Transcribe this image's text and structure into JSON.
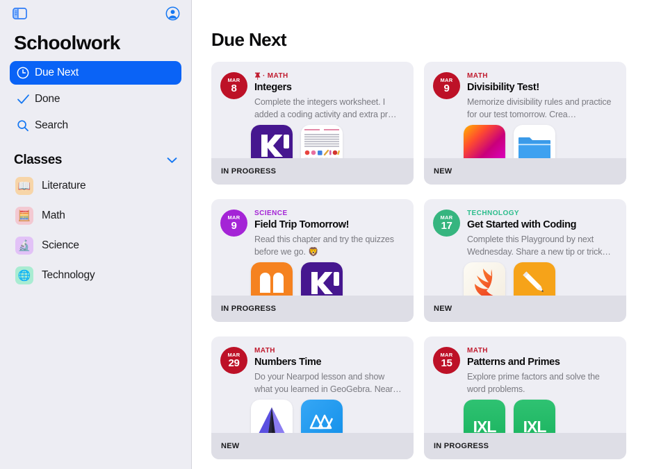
{
  "sidebar": {
    "toggle_icon": "sidebar-toggle-icon",
    "account_icon": "account-circle-icon",
    "app_title": "Schoolwork",
    "nav": [
      {
        "label": "Due Next",
        "icon": "clock-icon",
        "selected": true
      },
      {
        "label": "Done",
        "icon": "checkmark-icon",
        "selected": false
      },
      {
        "label": "Search",
        "icon": "search-icon",
        "selected": false
      }
    ],
    "classes_section": {
      "title": "Classes",
      "collapse_icon": "chevron-down-icon",
      "items": [
        {
          "label": "Literature",
          "emoji": "📖",
          "bg": "#f7d5a8"
        },
        {
          "label": "Math",
          "emoji": "🧮",
          "bg": "#f3c9d2"
        },
        {
          "label": "Science",
          "emoji": "🔬",
          "bg": "#e2c2f7"
        },
        {
          "label": "Technology",
          "emoji": "🌐",
          "bg": "#a9ecd2"
        }
      ]
    }
  },
  "main": {
    "title": "Due Next",
    "cards": [
      {
        "month": "MAR",
        "day": "8",
        "badge_color": "#bd1127",
        "class_name": "MATH",
        "class_color": "#c01b2e",
        "pinned": true,
        "pin_icon": "pin-icon",
        "title": "Integers",
        "description": "Complete the integers worksheet. I added a coding activity and extra pr…",
        "status": "IN PROGRESS",
        "thumbs": [
          {
            "name": "kahoot-app-icon",
            "kind": "kahoot"
          },
          {
            "name": "worksheet-document-thumbnail",
            "kind": "worksheet"
          }
        ]
      },
      {
        "month": "MAR",
        "day": "9",
        "badge_color": "#bd1127",
        "class_name": "MATH",
        "class_color": "#c01b2e",
        "pinned": false,
        "pin_icon": "",
        "title": "Divisibility Test!",
        "description": "Memorize divisibility rules and practice for our test tomorrow. Crea…",
        "status": "NEW",
        "thumbs": [
          {
            "name": "keynote-presentation-thumbnail",
            "kind": "gradient"
          },
          {
            "name": "files-folder-icon",
            "kind": "folder"
          }
        ]
      },
      {
        "month": "MAR",
        "day": "9",
        "badge_color": "#a424d6",
        "class_name": "SCIENCE",
        "class_color": "#a424d6",
        "pinned": false,
        "pin_icon": "",
        "title": "Field Trip Tomorrow!",
        "description": "Read this chapter and try the quizzes before we go. 🦁",
        "status": "IN PROGRESS",
        "thumbs": [
          {
            "name": "books-app-icon",
            "kind": "books"
          },
          {
            "name": "kahoot-app-icon",
            "kind": "kahoot"
          }
        ]
      },
      {
        "month": "MAR",
        "day": "17",
        "badge_color": "#36b57f",
        "class_name": "TECHNOLOGY",
        "class_color": "#2bbd8c",
        "pinned": false,
        "pin_icon": "",
        "title": "Get Started with Coding",
        "description": "Complete this Playground by next Wednesday. Share a new tip or trick…",
        "status": "NEW",
        "thumbs": [
          {
            "name": "swift-playgrounds-app-icon",
            "kind": "swift"
          },
          {
            "name": "notes-pencil-app-icon",
            "kind": "pencil"
          }
        ]
      },
      {
        "month": "MAR",
        "day": "29",
        "badge_color": "#bd1127",
        "class_name": "MATH",
        "class_color": "#c01b2e",
        "pinned": false,
        "pin_icon": "",
        "title": "Numbers Time",
        "description": "Do your Nearpod lesson and show what you learned in GeoGebra. Near…",
        "status": "NEW",
        "thumbs": [
          {
            "name": "nearpod-app-icon",
            "kind": "nearpod"
          },
          {
            "name": "geogebra-app-icon",
            "kind": "geogebra"
          }
        ]
      },
      {
        "month": "MAR",
        "day": "15",
        "badge_color": "#bd1127",
        "class_name": "MATH",
        "class_color": "#c01b2e",
        "pinned": false,
        "pin_icon": "",
        "title": "Patterns and Primes",
        "description": "Explore prime factors and solve the word problems.",
        "status": "IN PROGRESS",
        "thumbs": [
          {
            "name": "ixl-app-icon",
            "kind": "ixl"
          },
          {
            "name": "ixl-app-icon",
            "kind": "ixl"
          }
        ]
      }
    ]
  },
  "colors": {
    "accent": "#0a63f6",
    "sidebar_bg": "#ededf3",
    "card_bg": "#eeeef4",
    "card_footer_bg": "#dedee6"
  }
}
